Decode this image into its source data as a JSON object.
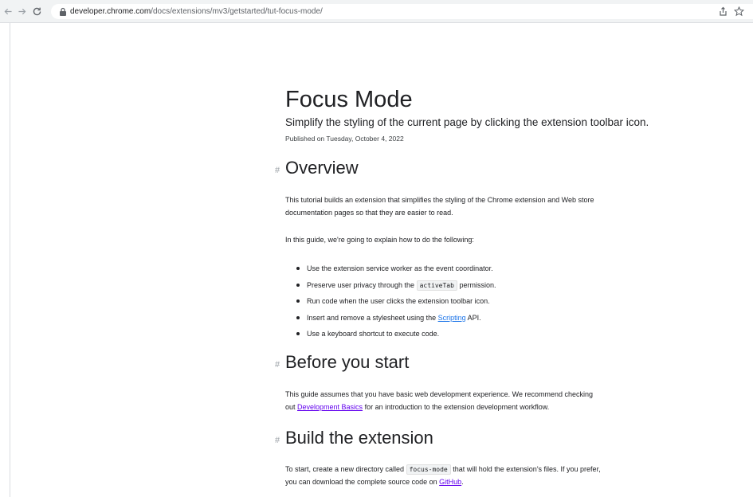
{
  "browser": {
    "url_host": "developer.chrome.com",
    "url_path": "/docs/extensions/mv3/getstarted/tut-focus-mode/",
    "icons": {
      "back": "arrow-left-icon",
      "forward": "arrow-right-icon",
      "reload": "reload-icon",
      "lock": "lock-icon",
      "share": "share-icon",
      "bookmark": "star-icon"
    }
  },
  "article": {
    "title": "Focus Mode",
    "subtitle": "Simplify the styling of the current page by clicking the extension toolbar icon.",
    "published": "Published on Tuesday, October 4, 2022",
    "hash_symbol": "#",
    "overview": {
      "heading": "Overview",
      "para1": "This tutorial builds an extension that simplifies the styling of the Chrome extension and Web store documentation pages so that they are easier to read.",
      "para2": "In this guide, we're going to explain how to do the following:",
      "items": [
        {
          "text": "Use the extension service worker as the event coordinator."
        },
        {
          "pre": "Preserve user privacy through the ",
          "code": "activeTab",
          "post": " permission."
        },
        {
          "text": "Run code when the user clicks the extension toolbar icon."
        },
        {
          "pre": "Insert and remove a stylesheet using the ",
          "link": "Scripting",
          "post": " API."
        },
        {
          "text": "Use a keyboard shortcut to execute code."
        }
      ]
    },
    "before": {
      "heading": "Before you start",
      "pre": "This guide assumes that you have basic web development experience. We recommend checking out ",
      "link": "Development Basics",
      "post": " for an introduction to the extension development workflow."
    },
    "build": {
      "heading": "Build the extension",
      "pre": "To start, create a new directory called ",
      "code": "focus-mode",
      "mid": " that will hold the extension's files. If you prefer, you can download the complete source code on ",
      "link": "GitHub",
      "post": "."
    }
  },
  "colors": {
    "link": "#1a73e8",
    "link_visited": "#6200ee",
    "text": "#202124",
    "toolbar_bg": "#f1f3f4"
  }
}
